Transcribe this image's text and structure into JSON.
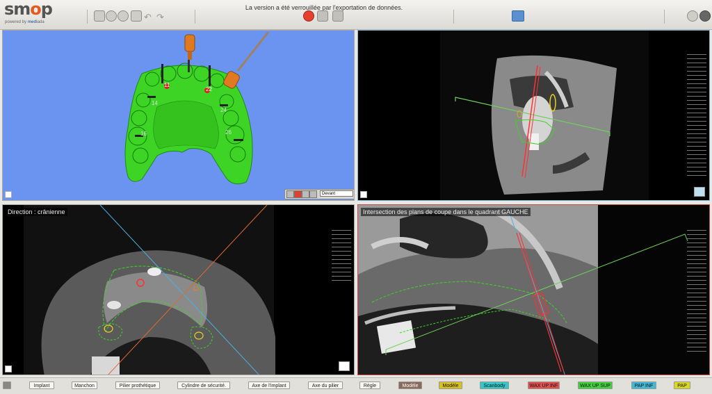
{
  "app": {
    "logo_main": "sm",
    "logo_o": "o",
    "logo_end": "p",
    "logo_powered": "powered by ",
    "logo_brand": "medi",
    "logo_brand2": "ada"
  },
  "toolbar": {
    "notice": "La version a été verrouillée par l'exportation de données."
  },
  "panels": {
    "top_left": {
      "view_select": "Devant"
    },
    "bottom_left": {
      "title": "Direction : crânienne"
    },
    "bottom_right": {
      "title": "Intersection des plans de coupe dans le quadrant GAUCHE"
    }
  },
  "implants": [
    "11",
    "22",
    "14",
    "24",
    "16",
    "26"
  ],
  "bottom_buttons": [
    {
      "label": "Implant",
      "color": "#f7f6f3"
    },
    {
      "label": "Manchon",
      "color": "#f7f6f3"
    },
    {
      "label": "Pilier prothétique",
      "color": "#f7f6f3"
    },
    {
      "label": "Cylindre de sécurité.",
      "color": "#f7f6f3"
    },
    {
      "label": "Axe de l'implant",
      "color": "#f7f6f3"
    },
    {
      "label": "Axe du pilier",
      "color": "#f7f6f3"
    },
    {
      "label": "Règle",
      "color": "#f7f6f3"
    },
    {
      "label": "Modèle",
      "color": "#8a6a5a"
    },
    {
      "label": "Modèle",
      "color": "#d8c020"
    },
    {
      "label": "Scanbody",
      "color": "#30c8c8"
    },
    {
      "label": "WAX UP INF",
      "color": "#e05050"
    },
    {
      "label": "WAX UP SUP",
      "color": "#40d040"
    },
    {
      "label": "PAP INF",
      "color": "#40b8d8"
    },
    {
      "label": "PAP",
      "color": "#d8d820"
    }
  ]
}
